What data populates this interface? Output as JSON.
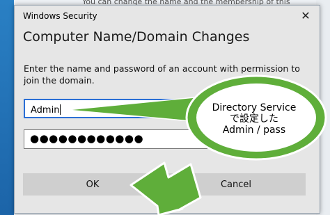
{
  "background": {
    "text": "You can change the name and the membership of this"
  },
  "dialog": {
    "window_title": "Windows Security",
    "heading": "Computer Name/Domain Changes",
    "instruction": "Enter the name and password of an account with permission to join the domain.",
    "username_value": "Admin",
    "password_value": "●●●●●●●●●●●●",
    "ok_label": "OK",
    "cancel_label": "Cancel",
    "close_glyph": "✕"
  },
  "annotation": {
    "line1": "Directory Service",
    "line2": "で設定した",
    "line3": "Admin / pass",
    "color": "#5fae3a"
  }
}
